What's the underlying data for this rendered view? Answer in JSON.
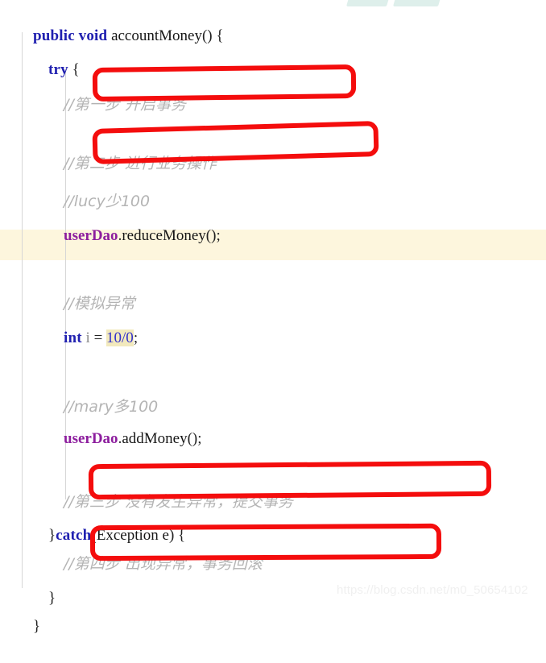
{
  "editor": {
    "language": "java",
    "background_color": "#ffffff",
    "current_line_highlight_color": "#fdf6dd",
    "annotation_color": "#f40d0d",
    "keyword_color": "#2020b0",
    "field_color": "#8d1e9e",
    "comment_color": "#b4b4b4",
    "number_color": "#3333cc",
    "search_highlight_color": "#f2e9bd",
    "indent_guide_color": "#d6d6d6"
  },
  "code": {
    "line1": {
      "kw_public": "public",
      "space1": " ",
      "kw_void": "void",
      "space2": " ",
      "method_name": "accountMoney",
      "parens": "()",
      "brace": " {"
    },
    "line2": {
      "indent": "    ",
      "kw_try": "try",
      "brace": " {"
    },
    "line3": {
      "indent": "        ",
      "comment": "//第一步 开启事务"
    },
    "line4": {
      "indent": "        ",
      "comment": "//第二步 进行业务操作"
    },
    "line5": {
      "indent": "        ",
      "comment": "//lucy少100"
    },
    "line6": {
      "indent": "        ",
      "field": "userDao",
      "dot": ".",
      "call": "reduceMoney",
      "parens": "()",
      "semi": ";"
    },
    "line7": {
      "indent": "        ",
      "comment": "//模拟异常"
    },
    "line8": {
      "indent": "        ",
      "kw_int": "int",
      "space": " ",
      "var": "i",
      "assign": " = ",
      "value": "10/0",
      "semi": ";"
    },
    "line9": {
      "indent": "        ",
      "comment": "//mary多100"
    },
    "line10": {
      "indent": "        ",
      "field": "userDao",
      "dot": ".",
      "call": "addMoney",
      "parens": "()",
      "semi": ";"
    },
    "line11": {
      "indent": "        ",
      "comment": "//第三步 没有发生异常，提交事务"
    },
    "line12": {
      "indent": "    ",
      "close_brace": "}",
      "kw_catch": "catch",
      "open_paren": "(",
      "exception_type": "Exception",
      "space": " ",
      "param": "e",
      "close_paren": ")",
      "brace": " {"
    },
    "line13": {
      "indent": "        ",
      "comment": "//第四步 出现异常，事务回滚"
    },
    "line14": {
      "indent": "    ",
      "close_brace": "}"
    },
    "line15": {
      "indent": "",
      "close_brace": "}"
    }
  },
  "annotations": {
    "box1_label": "第一步 开启事务",
    "box2_label": "第二步 进行业务操作",
    "box3_label": "第三步 没有发生异常，提交事务",
    "box4_label": "第四步 出现异常，事务回滚"
  },
  "watermark": {
    "bottom_text": "https://blog.csdn.net/m0_50654102"
  }
}
